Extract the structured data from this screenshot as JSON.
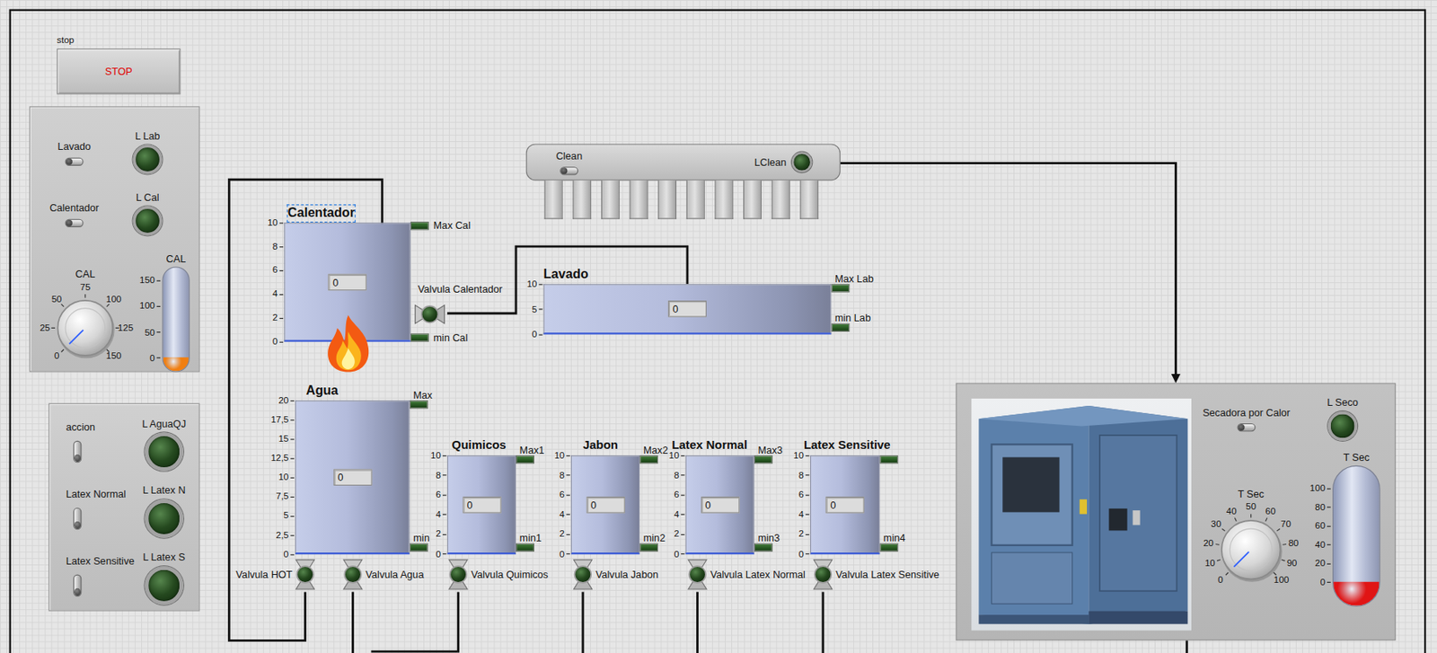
{
  "stop": {
    "caption": "stop",
    "button": "STOP"
  },
  "control_panel": {
    "switches": [
      {
        "label": "Lavado",
        "on": false,
        "led_label": "L Lab",
        "led_on": false
      },
      {
        "label": "Calentador",
        "on": false,
        "led_label": "L Cal",
        "led_on": false
      }
    ],
    "knob": {
      "label": "CAL",
      "ticks": [
        "0",
        "25",
        "50",
        "75",
        "100",
        "125",
        "150"
      ],
      "level": 0
    },
    "thermometer": {
      "label": "CAL",
      "ticks": [
        "150",
        "100",
        "50",
        "0"
      ],
      "level": 0,
      "color": "#f07f12"
    }
  },
  "latex_panel": {
    "switches": [
      {
        "label": "accion",
        "on": false,
        "led_label": "L AguaQJ",
        "led_on": false
      },
      {
        "label": "Latex Normal",
        "on": false,
        "led_label": "L Latex N",
        "led_on": false
      },
      {
        "label": "Latex Sensitive",
        "on": false,
        "led_label": "L Latex S",
        "led_on": false
      }
    ]
  },
  "clean": {
    "label": "Clean",
    "on": false,
    "led_label": "LClean",
    "led_on": false
  },
  "tanks": [
    {
      "name": "Calentador",
      "selected": true,
      "flame": true,
      "value": "0",
      "level": 0,
      "ticks": [
        "10",
        "8",
        "6",
        "4",
        "2",
        "0"
      ],
      "max": {
        "label": "Max Cal",
        "on": false
      },
      "min": {
        "label": "min Cal",
        "on": false
      }
    },
    {
      "name": "Lavado",
      "selected": false,
      "flame": false,
      "value": "0",
      "level": 0,
      "ticks": [
        "10",
        "5",
        "0"
      ],
      "max": {
        "label": "Max Lab",
        "on": false
      },
      "min": {
        "label": "min Lab",
        "on": false
      }
    },
    {
      "name": "Agua",
      "selected": false,
      "flame": false,
      "value": "0",
      "level": 0,
      "ticks": [
        "20",
        "17,5",
        "15",
        "12,5",
        "10",
        "7,5",
        "5",
        "2,5",
        "0"
      ],
      "max": {
        "label": "Max",
        "on": false
      },
      "min": {
        "label": "min",
        "on": false
      }
    },
    {
      "name": "Quimicos",
      "selected": false,
      "flame": false,
      "value": "0",
      "level": 0,
      "ticks": [
        "10",
        "8",
        "6",
        "4",
        "2",
        "0"
      ],
      "max": {
        "label": "Max1",
        "on": false
      },
      "min": {
        "label": "min1",
        "on": false
      }
    },
    {
      "name": "Jabon",
      "selected": false,
      "flame": false,
      "value": "0",
      "level": 0,
      "ticks": [
        "10",
        "8",
        "6",
        "4",
        "2",
        "0"
      ],
      "max": {
        "label": "Max2",
        "on": false
      },
      "min": {
        "label": "min2",
        "on": false
      }
    },
    {
      "name": "Latex Normal",
      "selected": false,
      "flame": false,
      "value": "0",
      "level": 0,
      "ticks": [
        "10",
        "8",
        "6",
        "4",
        "2",
        "0"
      ],
      "max": {
        "label": "Max3",
        "on": false
      },
      "min": {
        "label": "min3",
        "on": false
      }
    },
    {
      "name": "Latex Sensitive",
      "selected": false,
      "flame": false,
      "value": "0",
      "level": 0,
      "ticks": [
        "10",
        "8",
        "6",
        "4",
        "2",
        "0"
      ],
      "max": {
        "on": false
      },
      "min": {
        "label": "min4",
        "on": false
      }
    }
  ],
  "valves": [
    {
      "label": "Valvula Calentador",
      "open": false
    },
    {
      "label": "Valvula HOT",
      "open": false
    },
    {
      "label": "Valvula Agua",
      "open": false
    },
    {
      "label": "Valvula Quimicos",
      "open": false
    },
    {
      "label": "Valvula Jabon",
      "open": false
    },
    {
      "label": "Valvula Latex Normal",
      "open": false
    },
    {
      "label": "Valvula Latex Sensitive",
      "open": false
    }
  ],
  "dryer": {
    "switch": {
      "label": "Secadora por Calor",
      "on": false
    },
    "led": {
      "label": "L Seco",
      "on": false
    },
    "knob": {
      "label": "T Sec",
      "ticks": [
        "0",
        "10",
        "20",
        "30",
        "40",
        "50",
        "60",
        "70",
        "80",
        "90",
        "100"
      ],
      "level": 0
    },
    "thermometer": {
      "label": "T Sec",
      "ticks": [
        "100",
        "80",
        "60",
        "40",
        "20",
        "0"
      ],
      "level": 0,
      "color": "#e01515"
    }
  }
}
